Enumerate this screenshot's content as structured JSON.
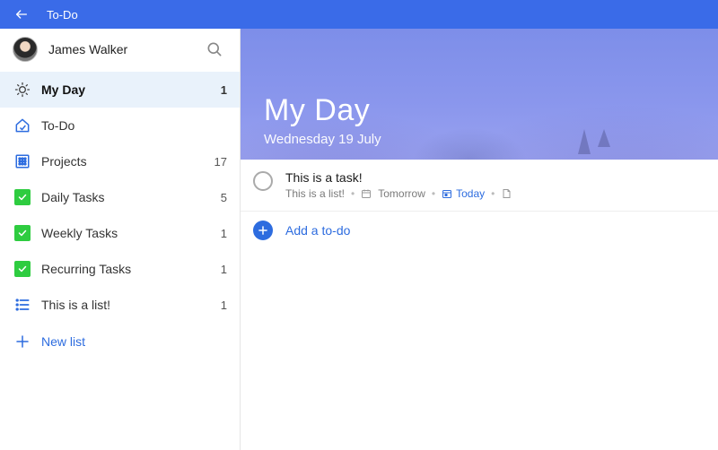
{
  "titlebar": {
    "app_name": "To-Do"
  },
  "user": {
    "name": "James Walker"
  },
  "sidebar": {
    "items": [
      {
        "label": "My Day",
        "count": "1",
        "icon": "sun",
        "active": true
      },
      {
        "label": "To-Do",
        "count": "",
        "icon": "home",
        "active": false
      },
      {
        "label": "Projects",
        "count": "17",
        "icon": "grid",
        "active": false
      },
      {
        "label": "Daily Tasks",
        "count": "5",
        "icon": "check",
        "active": false
      },
      {
        "label": "Weekly Tasks",
        "count": "1",
        "icon": "check",
        "active": false
      },
      {
        "label": "Recurring Tasks",
        "count": "1",
        "icon": "check",
        "active": false
      },
      {
        "label": "This is a list!",
        "count": "1",
        "icon": "bullets",
        "active": false
      }
    ],
    "new_list_label": "New list"
  },
  "main": {
    "title": "My Day",
    "date": "Wednesday 19 July",
    "task": {
      "title": "This is a task!",
      "list": "This is a list!",
      "due": "Tomorrow",
      "today_label": "Today"
    },
    "add_placeholder": "Add a to-do"
  }
}
